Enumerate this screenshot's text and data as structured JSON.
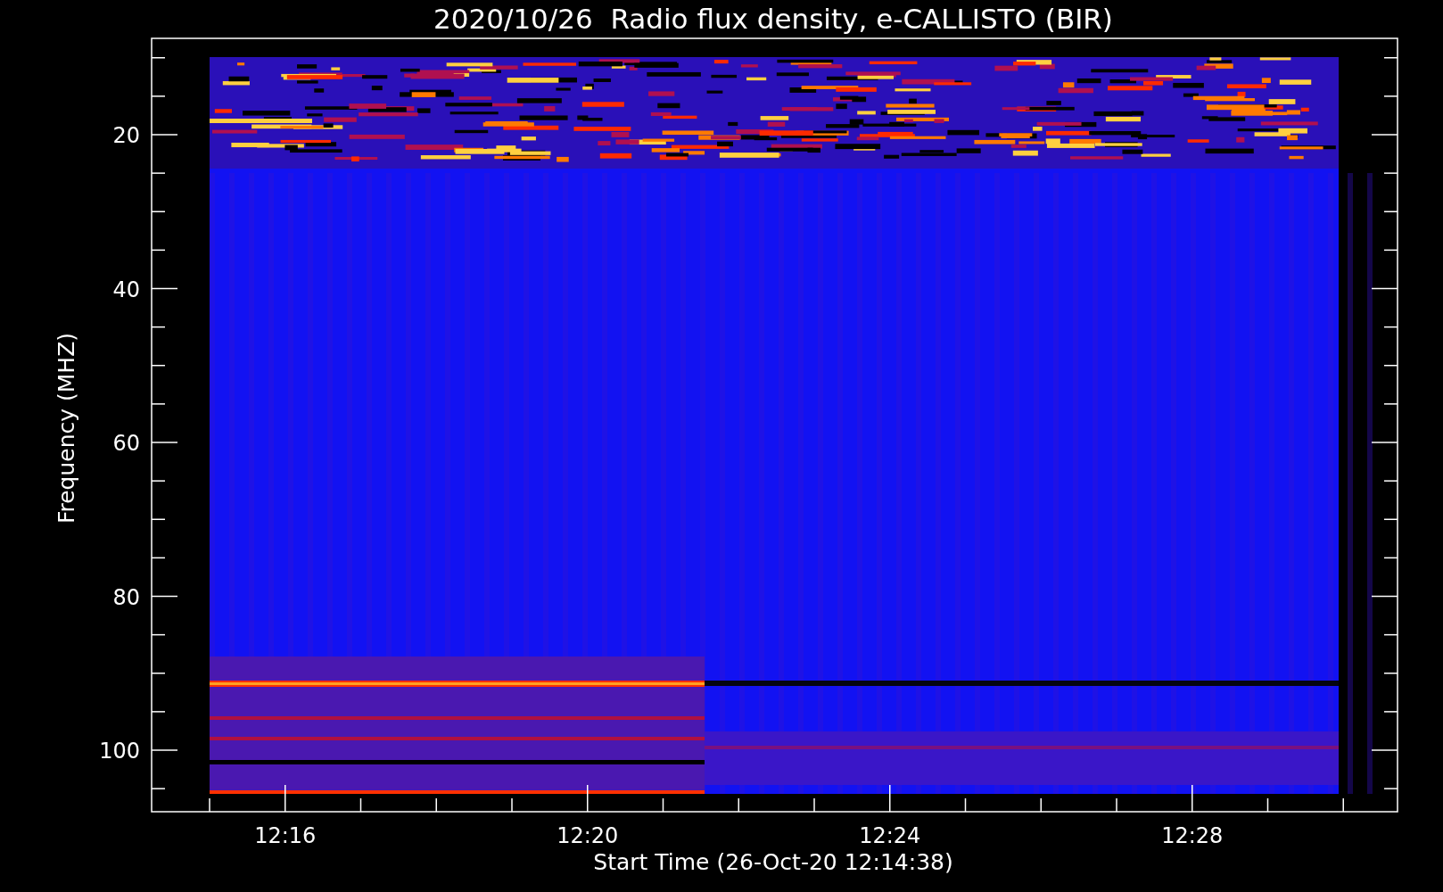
{
  "plot": {
    "title": "2020/10/26  Radio flux density, e-CALLISTO (BIR)",
    "xlabel": "Start Time (26-Oct-20 12:14:38)",
    "ylabel": "Frequency (MHZ)",
    "yticks": [
      "20",
      "40",
      "60",
      "80",
      "100"
    ],
    "xticks": [
      "12:16",
      "12:20",
      "12:24",
      "12:28"
    ]
  }
}
